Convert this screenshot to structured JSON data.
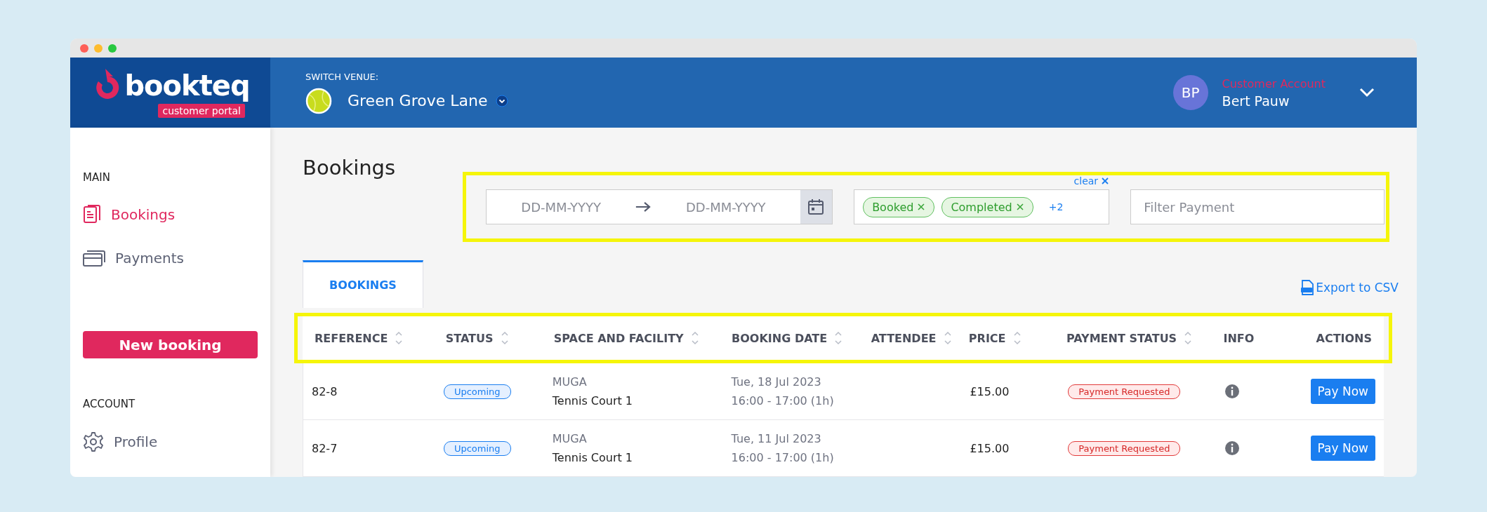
{
  "header": {
    "logo_text": "bookteq",
    "logo_badge": "customer portal",
    "venue_label": "SWITCH VENUE:",
    "venue_name": "Green Grove Lane",
    "user": {
      "initials": "BP",
      "role": "Customer Account",
      "name": "Bert Pauw"
    }
  },
  "sidebar": {
    "sections": [
      {
        "heading": "MAIN",
        "items": [
          {
            "label": "Bookings",
            "kind": "bookings",
            "selected": true
          },
          {
            "label": "Payments",
            "kind": "payments",
            "selected": false
          }
        ]
      },
      {
        "heading": "ACCOUNT",
        "items": [
          {
            "label": "Profile",
            "kind": "profile",
            "selected": false
          }
        ]
      }
    ],
    "new_booking": "New booking"
  },
  "page_title": "Bookings",
  "filters": {
    "date_from": {
      "placeholder": "DD-MM-YYYY"
    },
    "date_to": {
      "placeholder": "DD-MM-YYYY"
    },
    "clear": "clear",
    "status_tags": [
      "Booked",
      "Completed"
    ],
    "more": "+2",
    "payment": {
      "placeholder": "Filter Payment"
    }
  },
  "tabs": [
    {
      "label": "BOOKINGS",
      "selected": true
    }
  ],
  "export": "Export to CSV",
  "table": {
    "columns": [
      {
        "label": "REFERENCE",
        "sortable": true
      },
      {
        "label": "STATUS",
        "sortable": true
      },
      {
        "label": "SPACE AND FACILITY",
        "sortable": true
      },
      {
        "label": "BOOKING DATE",
        "sortable": true
      },
      {
        "label": "ATTENDEE",
        "sortable": true
      },
      {
        "label": "PRICE",
        "sortable": true
      },
      {
        "label": "PAYMENT STATUS",
        "sortable": true
      },
      {
        "label": "INFO",
        "sortable": false
      },
      {
        "label": "ACTIONS",
        "sortable": false
      }
    ],
    "rows": [
      {
        "reference": "82-8",
        "status": "Upcoming",
        "space": "MUGA",
        "facility": "Tennis Court 1",
        "date": "Tue, 18 Jul 2023",
        "time": "16:00 - 17:00 (1h)",
        "price": "£15.00",
        "payment_status": "Payment Requested",
        "action": "Pay Now"
      },
      {
        "reference": "82-7",
        "status": "Upcoming",
        "space": "MUGA",
        "facility": "Tennis Court 1",
        "date": "Tue, 11 Jul 2023",
        "time": "16:00 - 17:00 (1h)",
        "price": "£15.00",
        "payment_status": "Payment Requested",
        "action": "Pay Now"
      }
    ]
  }
}
